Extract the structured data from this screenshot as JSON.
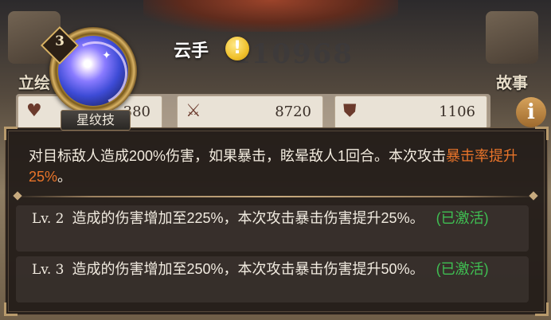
{
  "background": {
    "score": "410968",
    "left_button_label": "立绘",
    "right_button_label": "故事",
    "stats": [
      {
        "icon": "heart-icon",
        "value": "380"
      },
      {
        "icon": "sword-icon",
        "value": "8720"
      },
      {
        "icon": "shield-icon",
        "value": "1106"
      }
    ]
  },
  "skill": {
    "name": "云手",
    "level_badge": "3",
    "tag": "星纹技",
    "icon": "star-orb-icon",
    "warning_icon": "exclamation-icon"
  },
  "description": {
    "part1": "对目标敌人造成200%伤害，如果暴击，眩晕敌人1回合。本次攻击",
    "highlight": "暴击率提升25%",
    "part2": "。"
  },
  "levels": [
    {
      "label": "Lv. 2",
      "text": "造成的伤害增加至225%，本次攻击暴击伤害提升25%。",
      "status": "(已激活)"
    },
    {
      "label": "Lv. 3",
      "text": "造成的伤害增加至250%，本次攻击暴击伤害提升50%。",
      "status": "(已激活)"
    }
  ],
  "colors": {
    "highlight": "#e8742a",
    "active": "#3fbf52",
    "panel": "#211b18"
  }
}
